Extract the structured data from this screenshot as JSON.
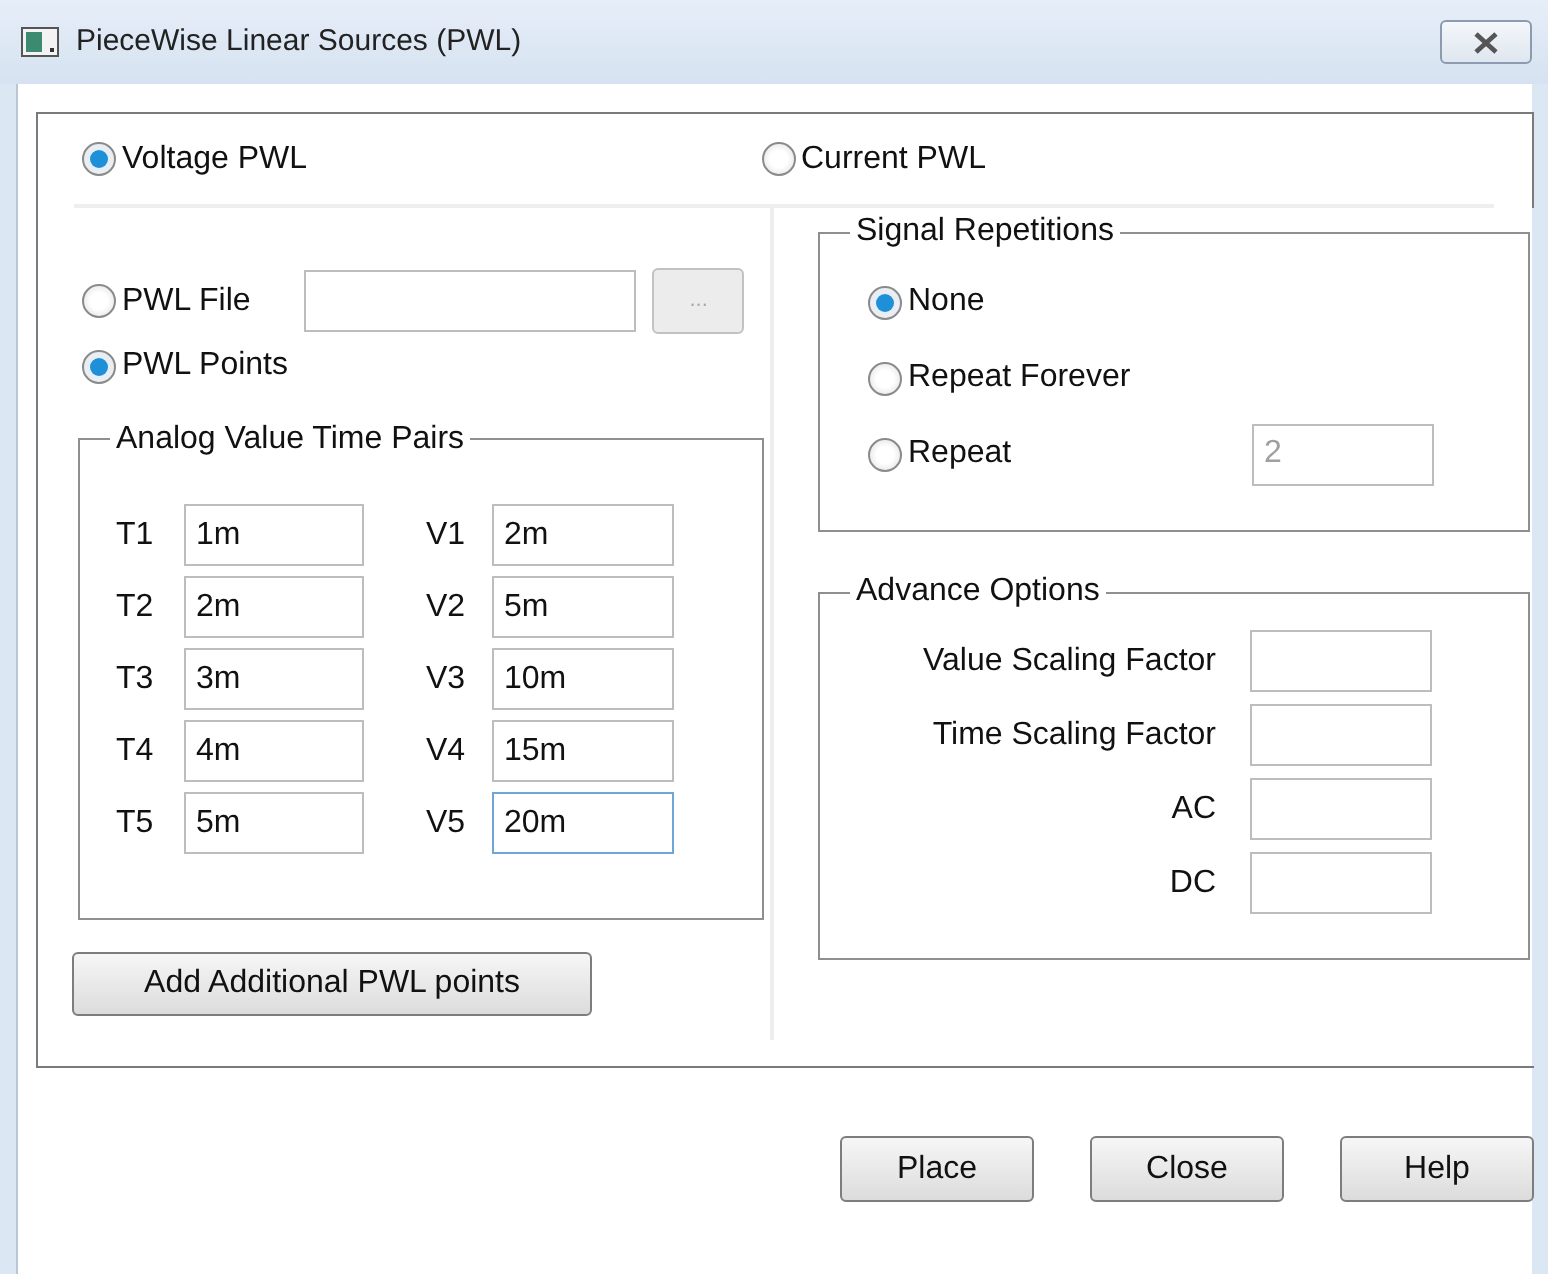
{
  "window": {
    "title": "PieceWise Linear Sources (PWL)"
  },
  "source_type": [
    {
      "label": "Voltage PWL",
      "selected": true
    },
    {
      "label": "Current PWL",
      "selected": false
    }
  ],
  "input_mode": [
    {
      "label": "PWL File",
      "selected": false
    },
    {
      "label": "PWL Points",
      "selected": true
    }
  ],
  "pwl_file": {
    "browse_label": "...",
    "browse_disabled": true
  },
  "pairs_group": {
    "title": "Analog Value Time Pairs",
    "rows": [
      {
        "time_label": "T1",
        "time_value": "1m",
        "value_label": "V1",
        "value": "2m",
        "value_focused": false
      },
      {
        "time_label": "T2",
        "time_value": "2m",
        "value_label": "V2",
        "value": "5m",
        "value_focused": false
      },
      {
        "time_label": "T3",
        "time_value": "3m",
        "value_label": "V3",
        "value": "10m",
        "value_focused": false
      },
      {
        "time_label": "T4",
        "time_value": "4m",
        "value_label": "V4",
        "value": "15m",
        "value_focused": false
      },
      {
        "time_label": "T5",
        "time_value": "5m",
        "value_label": "V5",
        "value": "20m",
        "value_focused": true
      }
    ]
  },
  "add_button": "Add Additional PWL points",
  "repetitions": {
    "title": "Signal Repetitions",
    "options": [
      {
        "label": "None",
        "selected": true
      },
      {
        "label": "Repeat Forever",
        "selected": false
      },
      {
        "label": "Repeat",
        "selected": false
      }
    ],
    "count": {
      "value": "2",
      "disabled": true
    }
  },
  "advance": {
    "title": "Advance Options",
    "fields": [
      {
        "label": "Value Scaling Factor"
      },
      {
        "label": "Time Scaling Factor"
      },
      {
        "label": "AC"
      },
      {
        "label": "DC"
      }
    ]
  },
  "buttons": [
    "Place",
    "Close",
    "Help"
  ]
}
